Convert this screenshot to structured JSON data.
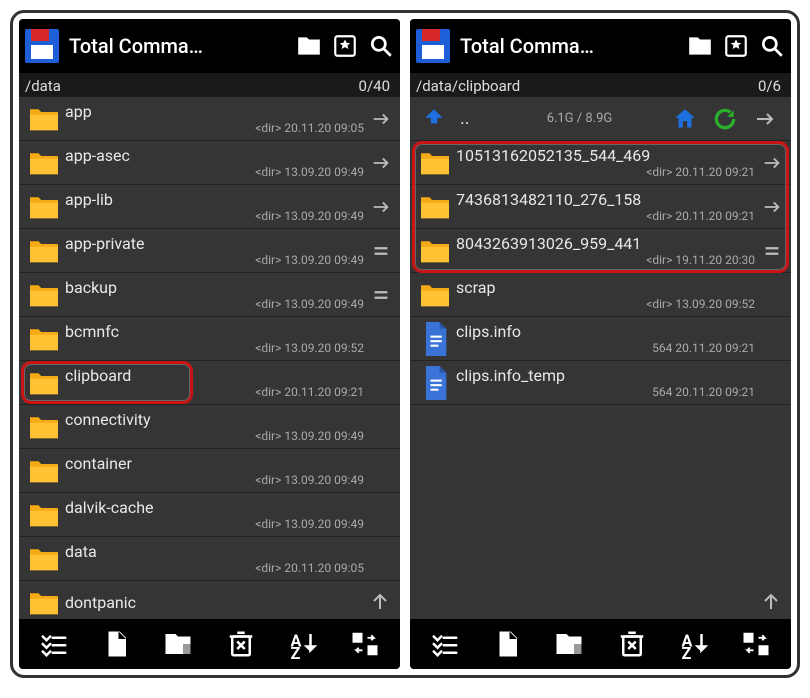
{
  "app_title": "Total Comma…",
  "left": {
    "path": "/data",
    "counter": "0/40",
    "rows": [
      {
        "name": "app",
        "meta": "<dir>  20.11.20  09:05",
        "side": "arrow"
      },
      {
        "name": "app-asec",
        "meta": "<dir>  13.09.20  09:49",
        "side": "arrow"
      },
      {
        "name": "app-lib",
        "meta": "<dir>  13.09.20  09:49",
        "side": "arrow"
      },
      {
        "name": "app-private",
        "meta": "<dir>  13.09.20  09:49",
        "side": "eq"
      },
      {
        "name": "backup",
        "meta": "<dir>  13.09.20  09:49",
        "side": "eq"
      },
      {
        "name": "bcmnfc",
        "meta": "<dir>  13.09.20  09:52",
        "side": ""
      },
      {
        "name": "clipboard",
        "meta": "<dir>  20.11.20  09:21",
        "side": "",
        "hl": true
      },
      {
        "name": "connectivity",
        "meta": "<dir>  13.09.20  09:49",
        "side": ""
      },
      {
        "name": "container",
        "meta": "<dir>  13.09.20  09:49",
        "side": ""
      },
      {
        "name": "dalvik-cache",
        "meta": "<dir>  13.09.20  09:49",
        "side": ""
      },
      {
        "name": "data",
        "meta": "<dir>  20.11.20  09:05",
        "side": ""
      },
      {
        "name": "dontpanic",
        "meta": "",
        "side": ""
      }
    ]
  },
  "right": {
    "path": "/data/clipboard",
    "counter": "0/6",
    "nav": {
      "dots": "..",
      "space": "6.1G / 8.9G"
    },
    "rows": [
      {
        "name": "10513162052135_544_469",
        "meta": "<dir>  20.11.20  09:21",
        "side": "arrow",
        "type": "folder"
      },
      {
        "name": "7436813482110_276_158",
        "meta": "<dir>  20.11.20  09:21",
        "side": "arrow",
        "type": "folder"
      },
      {
        "name": "8043263913026_959_441",
        "meta": "<dir>  19.11.20  20:30",
        "side": "eq",
        "type": "folder"
      },
      {
        "name": "scrap",
        "meta": "<dir>  13.09.20  09:52",
        "side": "",
        "type": "folder"
      },
      {
        "name": "clips.info",
        "meta": "564  20.11.20  09:21",
        "side": "",
        "type": "doc"
      },
      {
        "name": "clips.info_temp",
        "meta": "564  20.11.20  09:21",
        "side": "",
        "type": "doc"
      }
    ],
    "hl_start": 0,
    "hl_end": 2
  }
}
